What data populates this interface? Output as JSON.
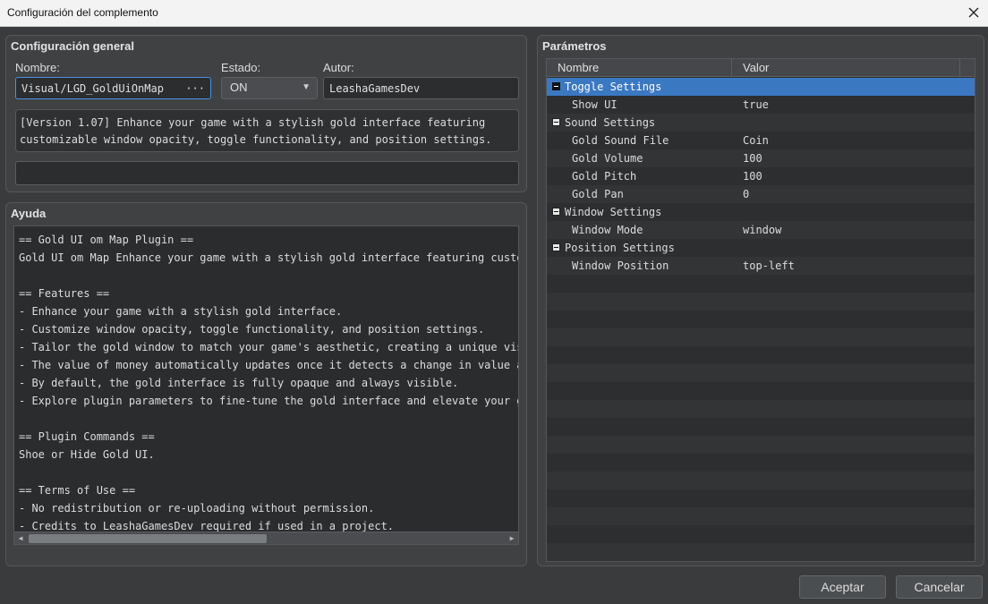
{
  "window": {
    "title": "Configuración del complemento"
  },
  "general": {
    "title": "Configuración general",
    "name_label": "Nombre:",
    "name_value": "Visual/LGD_GoldUiOnMap",
    "name_button": "···",
    "status_label": "Estado:",
    "status_value": "ON",
    "author_label": "Autor:",
    "author_value": "LeashaGamesDev",
    "description": [
      "[Version 1.07] Enhance your game with a stylish gold interface featuring",
      "customizable window opacity, toggle functionality, and position settings."
    ],
    "extra_value": ""
  },
  "help": {
    "title": "Ayuda",
    "lines": [
      "== Gold UI om Map Plugin ==",
      "Gold UI om Map Enhance your game with a stylish gold interface featuring custom",
      "",
      "== Features ==",
      "- Enhance your game with a stylish gold interface.",
      "- Customize window opacity, toggle functionality, and position settings.",
      "- Tailor the gold window to match your game's aesthetic, creating a unique visu",
      "- The value of money automatically updates once it detects a change in value an",
      "- By default, the gold interface is fully opaque and always visible.",
      "- Explore plugin parameters to fine-tune the gold interface and elevate your ga",
      "",
      "== Plugin Commands ==",
      "Shoe or Hide Gold UI.",
      "",
      "== Terms of Use ==",
      "- No redistribution or re-uploading without permission.",
      "- Credits to LeashaGamesDev required if used in a project."
    ],
    "scroll_fraction": 0.5
  },
  "params": {
    "title": "Parámetros",
    "col_name": "Nombre",
    "col_value": "Valor",
    "rows": [
      {
        "name": "Toggle Settings",
        "value": "",
        "group": true,
        "selected": true
      },
      {
        "name": "Show UI",
        "value": "true",
        "group": false
      },
      {
        "name": "Sound Settings",
        "value": "",
        "group": true
      },
      {
        "name": "Gold Sound File",
        "value": "Coin",
        "group": false
      },
      {
        "name": "Gold Volume",
        "value": "100",
        "group": false
      },
      {
        "name": "Gold Pitch",
        "value": "100",
        "group": false
      },
      {
        "name": "Gold Pan",
        "value": "0",
        "group": false
      },
      {
        "name": "Window Settings",
        "value": "",
        "group": true
      },
      {
        "name": "Window Mode",
        "value": "window",
        "group": false
      },
      {
        "name": "Position Settings",
        "value": "",
        "group": true
      },
      {
        "name": "Window Position",
        "value": "top-left",
        "group": false
      }
    ]
  },
  "footer": {
    "accept": "Aceptar",
    "cancel": "Cancelar"
  }
}
